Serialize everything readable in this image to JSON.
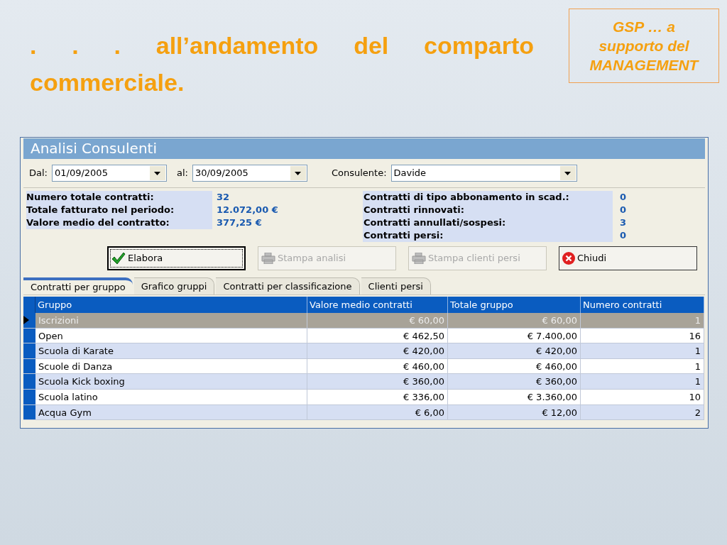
{
  "slide": {
    "title": ". . . all’andamento del comparto commerciale.",
    "badge": [
      "GSP … a",
      "supporto del",
      "MANAGEMENT"
    ]
  },
  "window": {
    "title": "Analisi Consulenti"
  },
  "filters": [
    {
      "label": "Dal:",
      "value": "01/09/2005"
    },
    {
      "label": "al:",
      "value": "30/09/2005"
    },
    {
      "label": "Consulente:",
      "value": "Davide"
    }
  ],
  "stats_left": [
    {
      "label": "Numero totale contratti:",
      "value": "32"
    },
    {
      "label": "Totale fatturato nel periodo:",
      "value": "12.072,00 €"
    },
    {
      "label": "Valore medio del contratto:",
      "value": "377,25 €"
    }
  ],
  "stats_right": [
    {
      "label": "Contratti di tipo abbonamento in scad.:",
      "value": "0"
    },
    {
      "label": "Contratti rinnovati:",
      "value": "0"
    },
    {
      "label": "Contratti annullati/sospesi:",
      "value": "3"
    },
    {
      "label": "Contratti persi:",
      "value": "0"
    }
  ],
  "buttons": [
    {
      "label": "Elabora",
      "kind": "check",
      "disabled": false,
      "focused": true
    },
    {
      "label": "Stampa analisi",
      "kind": "print",
      "disabled": true,
      "focused": false
    },
    {
      "label": "Stampa clienti persi",
      "kind": "print",
      "disabled": true,
      "focused": false
    },
    {
      "label": "Chiudi",
      "kind": "close",
      "disabled": false,
      "focused": false
    }
  ],
  "tabs": [
    {
      "label": "Contratti per gruppo",
      "selected": true
    },
    {
      "label": "Grafico gruppi",
      "selected": false
    },
    {
      "label": "Contratti per classificazione",
      "selected": false
    },
    {
      "label": "Clienti persi",
      "selected": false
    }
  ],
  "table": {
    "columns": [
      "Gruppo",
      "Valore medio contratti",
      "Totale gruppo",
      "Numero contratti"
    ],
    "rows": [
      {
        "cells": [
          "Iscrizioni",
          "€ 60,00",
          "€ 60,00",
          "1"
        ],
        "selected": true
      },
      {
        "cells": [
          "Open",
          "€ 462,50",
          "€ 7.400,00",
          "16"
        ],
        "selected": false
      },
      {
        "cells": [
          "Scuola di Karate",
          "€ 420,00",
          "€ 420,00",
          "1"
        ],
        "selected": false
      },
      {
        "cells": [
          "Scuole di Danza",
          "€ 460,00",
          "€ 460,00",
          "1"
        ],
        "selected": false
      },
      {
        "cells": [
          "Scuola Kick boxing",
          "€ 360,00",
          "€ 360,00",
          "1"
        ],
        "selected": false
      },
      {
        "cells": [
          "Scuola latino",
          "€ 336,00",
          "€ 3.360,00",
          "10"
        ],
        "selected": false
      },
      {
        "cells": [
          "Acqua Gym",
          "€ 6,00",
          "€ 12,00",
          "2"
        ],
        "selected": false
      }
    ]
  }
}
